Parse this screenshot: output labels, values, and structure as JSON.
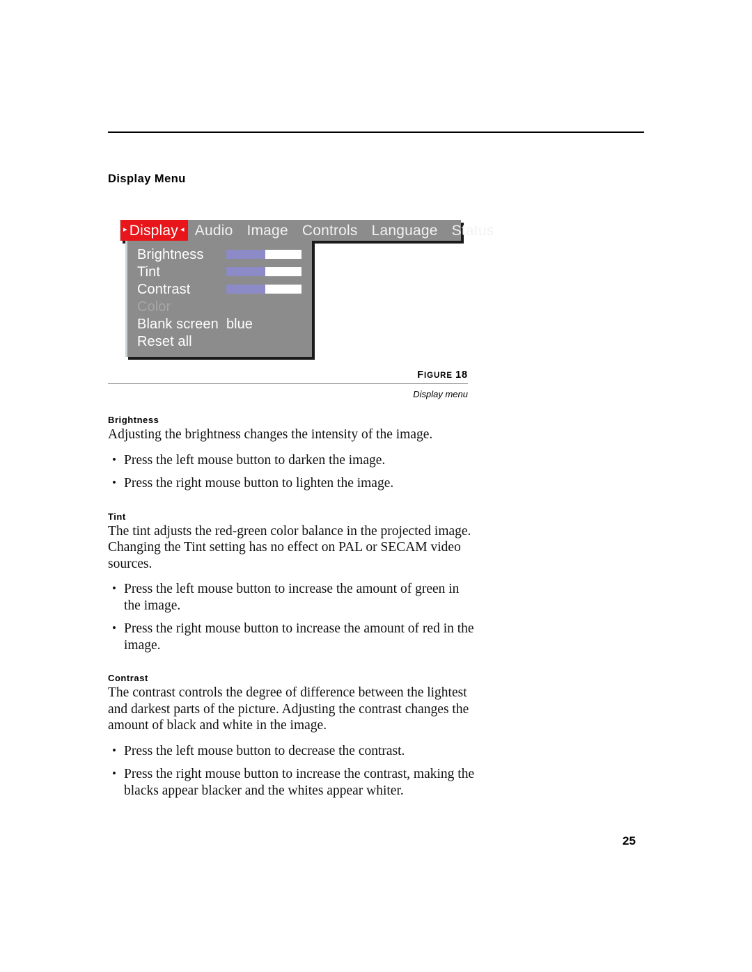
{
  "page": {
    "number": "25"
  },
  "heading": {
    "title": "Display Menu"
  },
  "osd": {
    "tabs": [
      {
        "label": "Display",
        "selected": true,
        "left_arrow": "▸",
        "right_arrow": "◂"
      },
      {
        "label": "Audio",
        "selected": false
      },
      {
        "label": "Image",
        "selected": false
      },
      {
        "label": "Controls",
        "selected": false
      },
      {
        "label": "Language",
        "selected": false
      },
      {
        "label": "Status",
        "selected": false
      }
    ],
    "menu_items": [
      {
        "label": "Brightness",
        "control": "slider",
        "fill_percent": 52,
        "disabled": false
      },
      {
        "label": "Tint",
        "control": "slider",
        "fill_percent": 52,
        "disabled": false
      },
      {
        "label": "Contrast",
        "control": "slider",
        "fill_percent": 52,
        "disabled": false
      },
      {
        "label": "Color",
        "control": "none",
        "disabled": true
      },
      {
        "label": "Blank screen",
        "control": "value",
        "value": "blue",
        "disabled": false
      },
      {
        "label": "Reset all",
        "control": "none",
        "disabled": false
      }
    ],
    "colors": {
      "bar_background": "#8c8c8c",
      "selected_tab_background": "#e8161b",
      "slider_fill": "#8c8ac7",
      "slider_track": "#ffffff",
      "disabled_text": "#a6a6a6",
      "highlight_edge": "#c9d5d8",
      "shadow": "#1a1a1a"
    }
  },
  "figure": {
    "label_prefix": "F",
    "label_rest": "IGURE",
    "label_number": "18",
    "caption": "Display menu"
  },
  "sections": [
    {
      "heading": "Brightness",
      "paragraph": "Adjusting the brightness changes the intensity of the image.",
      "bullets": [
        "Press the left mouse button to darken the image.",
        "Press the right mouse button to lighten the image."
      ]
    },
    {
      "heading": "Tint",
      "paragraph": "The tint adjusts the red-green color balance in the projected image. Changing the Tint setting has no effect on PAL or SECAM video sources.",
      "bullets": [
        "Press the left mouse button to increase the amount of green in the image.",
        "Press the right mouse button to increase the amount of red in the image."
      ]
    },
    {
      "heading": "Contrast",
      "paragraph": "The contrast controls the degree of difference between the lightest and darkest parts of the picture. Adjusting the contrast changes the amount of black and white in the image.",
      "bullets": [
        "Press the left mouse button to decrease the contrast.",
        "Press the right mouse button to increase the contrast, making the blacks appear blacker and the whites appear whiter."
      ]
    }
  ]
}
